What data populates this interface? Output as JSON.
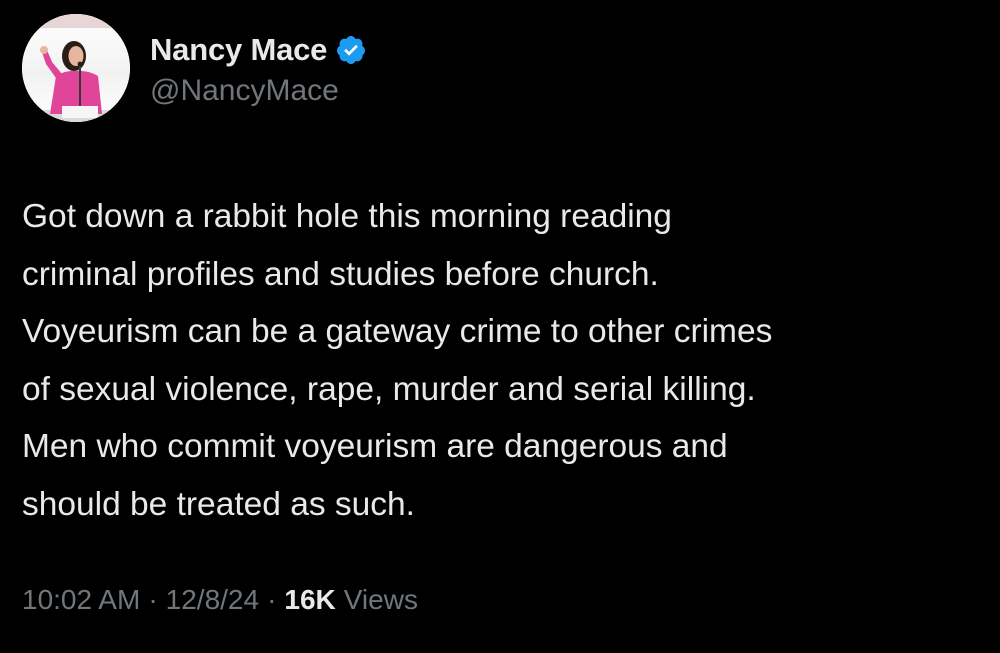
{
  "colors": {
    "background": "#000000",
    "primary_text": "#e7e9ea",
    "secondary_text": "#71767b",
    "verified_badge": "#1d9bf0"
  },
  "author": {
    "display_name": "Nancy Mace",
    "handle": "@NancyMace",
    "verified_icon": "verified-badge-icon"
  },
  "tweet": {
    "text": "Got down a rabbit hole this morning reading\ncriminal profiles and studies before church.\nVoyeurism can be a gateway crime to other crimes\nof sexual violence, rape, murder and serial killing.\nMen who commit voyeurism are dangerous and\nshould be treated as such."
  },
  "meta": {
    "time": "10:02 AM",
    "separator": "·",
    "date": "12/8/24",
    "views_count": "16K",
    "views_label": "Views"
  }
}
